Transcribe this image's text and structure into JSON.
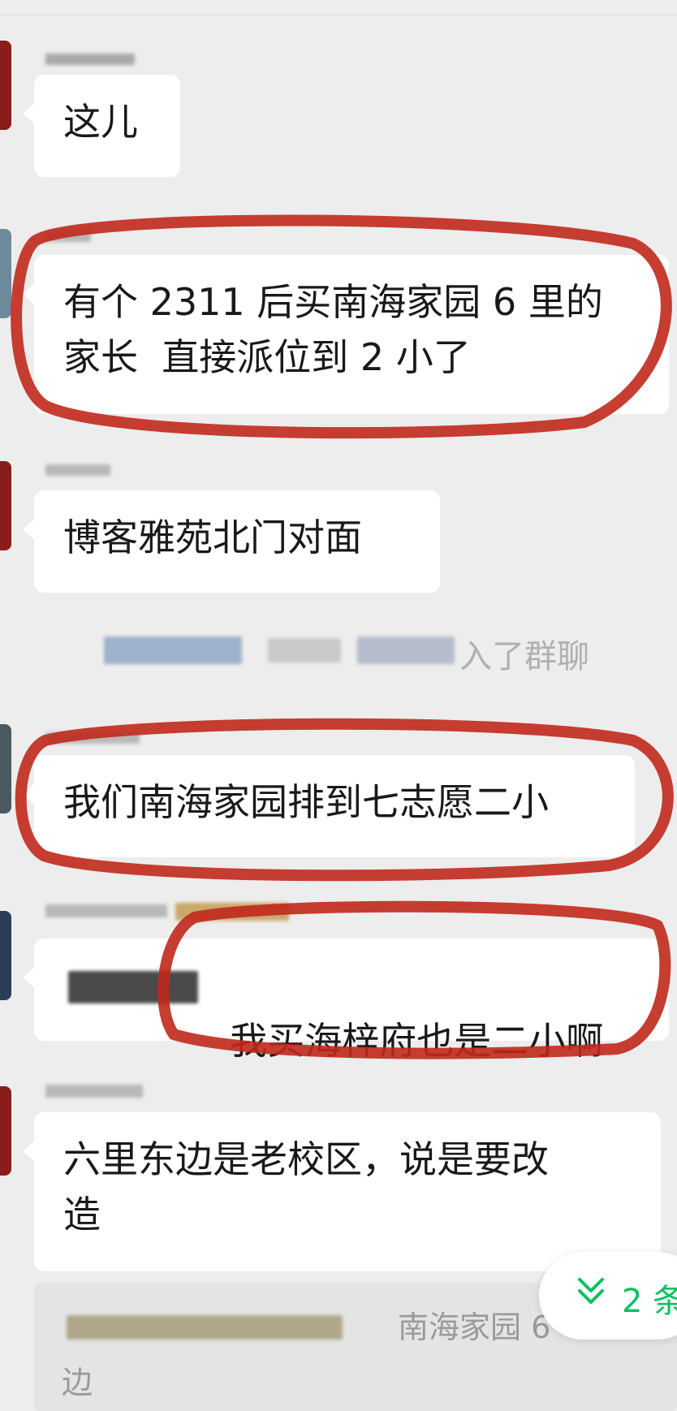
{
  "messages": [
    {
      "text": "这儿"
    },
    {
      "text": "有个 2311 后买南海家园 6 里的\n家长  直接派位到 2 小了"
    },
    {
      "text": "博客雅苑北门对面"
    },
    {
      "text": "我们南海家园排到七志愿二小"
    },
    {
      "text": "我买海梓府也是二小啊"
    },
    {
      "text": "六里东边是老校区，说是要改\n造"
    }
  ],
  "system_notice": {
    "text": "入了群聊"
  },
  "quote": {
    "line1": "南海家园 6",
    "line2": "边"
  },
  "new_messages_pill": {
    "label": "2 条",
    "icon": "double-chevron-down-icon"
  },
  "colors": {
    "accent_green": "#07c160",
    "annotation_red": "#c0281c",
    "bubble_bg": "#ffffff",
    "chat_bg": "#ededed"
  }
}
